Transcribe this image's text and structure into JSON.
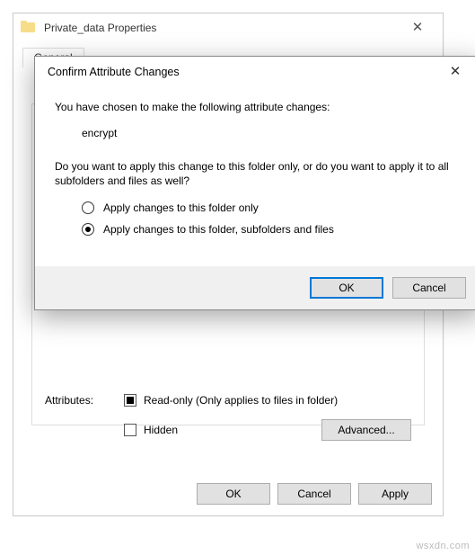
{
  "properties": {
    "title": "Private_data Properties",
    "tab_general": "General",
    "attributes_label": "Attributes:",
    "readonly_label": "Read-only (Only applies to files in folder)",
    "hidden_label": "Hidden",
    "advanced_button": "Advanced...",
    "ok": "OK",
    "cancel": "Cancel",
    "apply": "Apply"
  },
  "confirm": {
    "title": "Confirm Attribute Changes",
    "intro": "You have chosen to make the following attribute changes:",
    "change": "encrypt",
    "question": "Do you want to apply this change to this folder only, or do you want to apply it to all subfolders and files as well?",
    "opt_folder_only": "Apply changes to this folder only",
    "opt_recursive": "Apply changes to this folder, subfolders and files",
    "ok": "OK",
    "cancel": "Cancel"
  },
  "watermark": "wsxdn.com"
}
